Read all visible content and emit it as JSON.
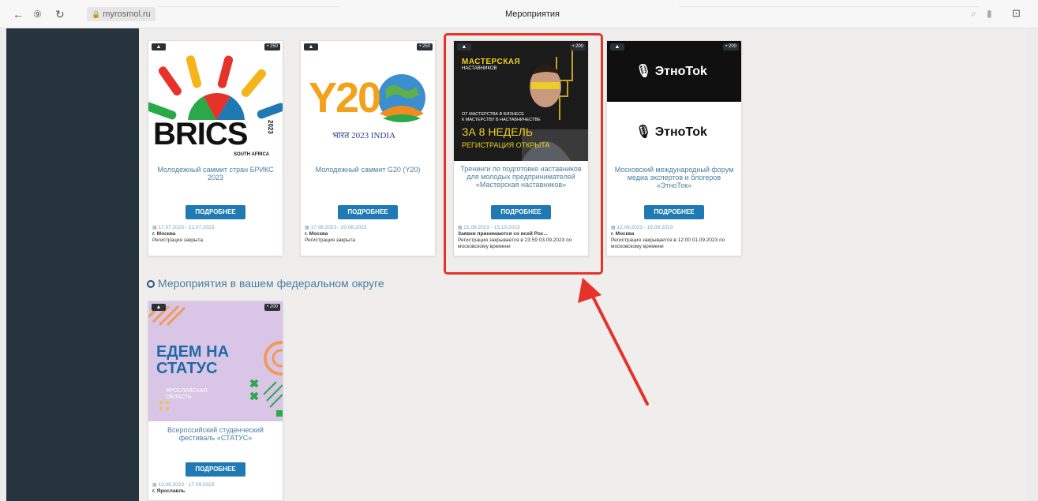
{
  "browser": {
    "url": "myrosmol.ru",
    "page_title": "Мероприятия"
  },
  "events": [
    {
      "title": "Молодежный саммит стран БРИКС 2023",
      "badge": "• 250",
      "button": "ПОДРОБНЕЕ",
      "date": "17.07.2023 - 21.07.2023",
      "city": "г. Москва",
      "status": "Регистрация закрыта",
      "image_text": {
        "main": "BRICS",
        "year": "2023",
        "sub": "SOUTH AFRICA"
      }
    },
    {
      "title": "Молодежный саммит G20 (Y20)",
      "badge": "• 250",
      "button": "ПОДРОБНЕЕ",
      "date": "17.08.2023 - 20.08.2023",
      "city": "г. Москва",
      "status": "Регистрация закрыта",
      "image_text": {
        "main": "Y20",
        "sub": "भारत 2023 INDIA"
      }
    },
    {
      "title": "Тренинги по подготовке наставников для молодых предпринимателей «Мастерская наставников»",
      "badge": "• 200",
      "button": "ПОДРОБНЕЕ",
      "date": "21.08.2023 - 15.10.2023",
      "city": "Заявки принимаются со всей Рос...",
      "status": "Регистрация закрывается в 23:59 03.09.2023 по московскому времени",
      "image_text": {
        "top": "МАСТЕРСКАЯ",
        "top2": "НАСТАВНИКОВ",
        "line1": "ОТ МАСТЕРСТВА В БИЗНЕСЕ",
        "line2": "К МАСТЕРСТВУ В НАСТАВНИЧЕСТВЕ",
        "big": "ЗА 8 НЕДЕЛЬ",
        "reg": "РЕГИСТРАЦИЯ ОТКРЫТА"
      }
    },
    {
      "title": "Московский международный форум медиа экспертов и блогеров «ЭтноТок»",
      "badge": "• 200",
      "button": "ПОДРОБНЕЕ",
      "date": "12.09.2023 - 16.09.2023",
      "city": "г. Москва",
      "status": "Регистрация закрывается в 12:00 01.09.2023 по московскому времени",
      "image_text": {
        "logo": "ЭтноТоk"
      }
    }
  ],
  "section": {
    "heading": "Мероприятия в вашем федеральном округе"
  },
  "regional_event": {
    "title": "Всероссийский студенческий фестиваль «СТАТУС»",
    "badge": "• 200",
    "button": "ПОДРОБНЕЕ",
    "date": "13.09.2023 - 17.09.2023",
    "city": "г. Ярославль",
    "image_text": {
      "line1": "ЕДЕМ НА",
      "line2": "СТАТУС",
      "region1": "ЯРОСЛАВСКАЯ",
      "region2": "ОБЛАСТЬ"
    }
  },
  "colors": {
    "sidebar": "#26343d",
    "button": "#1f7ab4",
    "link": "#4a7fa1",
    "highlight": "#e5332a"
  }
}
